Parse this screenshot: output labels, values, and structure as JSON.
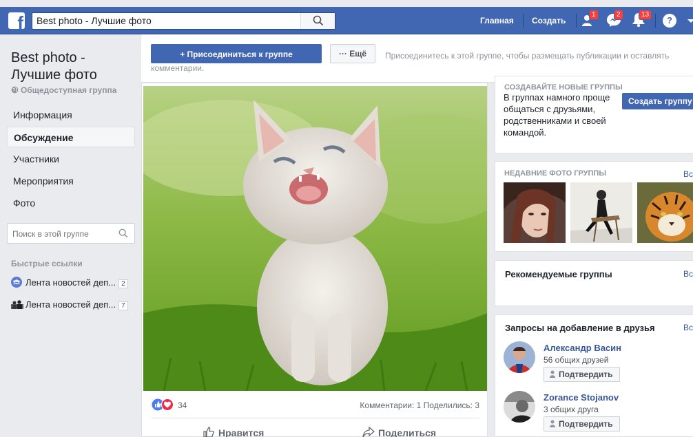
{
  "topbar": {
    "search_value": "Best photo - Лучшие фото",
    "home_label": "Главная",
    "create_label": "Создать",
    "friend_requests_badge": "1",
    "messages_badge": "2",
    "notifications_badge": "13",
    "help_label": "?"
  },
  "sidebar": {
    "group_name": "Best photo - Лучшие фото",
    "group_type": "Общедоступная группа",
    "items": [
      {
        "label": "Информация"
      },
      {
        "label": "Обсуждение"
      },
      {
        "label": "Участники"
      },
      {
        "label": "Мероприятия"
      },
      {
        "label": "Фото"
      }
    ],
    "search_placeholder": "Поиск в этой группе",
    "quick_links_title": "Быстрые ссылки",
    "quick_links": [
      {
        "label": "Лента новостей деп...",
        "count": "2"
      },
      {
        "label": "Лента новостей деп...",
        "count": "7"
      }
    ]
  },
  "join_bar": {
    "join_label": "+ Присоединиться к группе",
    "more_label": "··· Ещё",
    "hint": "Присоединитесь к этой группе, чтобы размещать публикации и оставлять комментарии."
  },
  "post": {
    "reaction_count": "34",
    "stats": "Комментарии: 1  Поделились: 3",
    "like_label": "Нравится",
    "share_label": "Поделиться"
  },
  "right": {
    "create_title": "СОЗДАВАЙТЕ НОВЫЕ ГРУППЫ",
    "create_text": "В группах намного проще общаться с друзьями, родственниками и своей командой.",
    "create_button": "Создать группу",
    "recent_photos_title": "НЕДАВНИЕ ФОТО ГРУППЫ",
    "see_all": "Вс",
    "suggested_title": "Рекомендуемые группы",
    "requests_title": "Запросы на добавление в друзья",
    "friends": [
      {
        "name": "Александр Васин",
        "mutual": "56 общих друзей",
        "confirm": "Подтвердить"
      },
      {
        "name": "Zorance Stojanov",
        "mutual": "3 общих друга",
        "confirm": "Подтвердить"
      }
    ]
  },
  "colors": {
    "brand": "#4267b2",
    "link": "#385898",
    "badge": "#fa3e3e"
  }
}
